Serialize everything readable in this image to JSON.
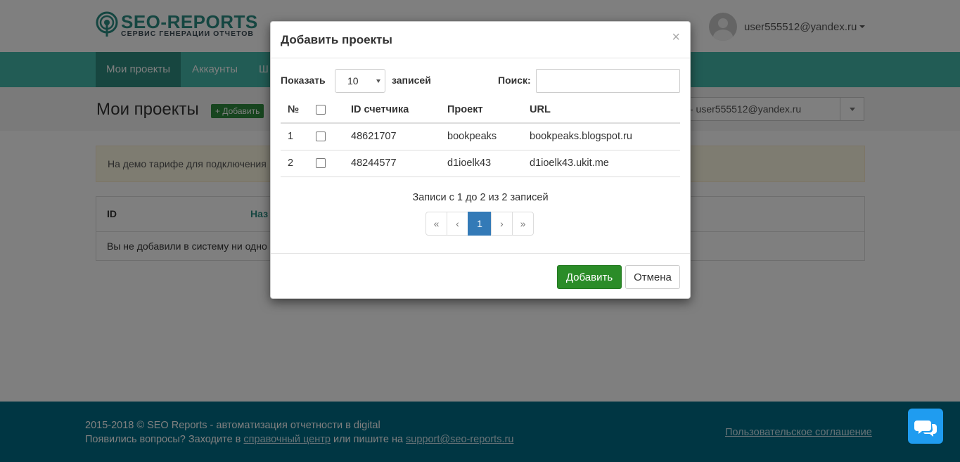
{
  "brand": {
    "title": "SEO-REPORTS",
    "subtitle": "СЕРВИС ГЕНЕРАЦИИ ОТЧЕТОВ",
    "accent": "#2a8c83"
  },
  "user": {
    "email": "user555512@yandex.ru"
  },
  "nav": {
    "items": [
      "Мои проекты",
      "Аккаунты",
      "Ш"
    ],
    "active_index": 0
  },
  "page": {
    "title": "Мои проекты",
    "add_label": "+ Добавить",
    "account_select": "- user555512@yandex.ru",
    "alert": "На демо тарифе для подключения",
    "table_headers": [
      "ID",
      "Наз"
    ],
    "empty_text": "Вы не добавили в систему ни одно"
  },
  "modal": {
    "title": "Добавить проекты",
    "close": "×",
    "show_label": "Показать",
    "length_value": "10",
    "entries_label": "записей",
    "search_label": "Поиск:",
    "search_value": "",
    "columns": [
      "№",
      "",
      "ID счетчика",
      "Проект",
      "URL"
    ],
    "rows": [
      {
        "num": "1",
        "counter_id": "48621707",
        "project": "bookpeaks",
        "url": "bookpeaks.blogspot.ru"
      },
      {
        "num": "2",
        "counter_id": "48244577",
        "project": "d1ioelk43",
        "url": "d1ioelk43.ukit.me"
      }
    ],
    "info": "Записи с 1 до 2 из 2 записей",
    "pager": {
      "first": "«",
      "prev": "‹",
      "current": "1",
      "next": "›",
      "last": "»"
    },
    "add_button": "Добавить",
    "cancel_button": "Отмена"
  },
  "footer": {
    "line1": "2015-2018 © SEO Reports - автоматизация отчетности в digital",
    "line2_prefix": "Появились вопросы? Заходите в ",
    "help_link": "справочный центр",
    "line2_mid": " или пишите на ",
    "email_link": "support@seo-reports.ru",
    "agreement": "Пользовательское соглашение"
  },
  "icons": {
    "chat": "chat-bubbles-icon",
    "logo": "signal-pin-icon"
  }
}
